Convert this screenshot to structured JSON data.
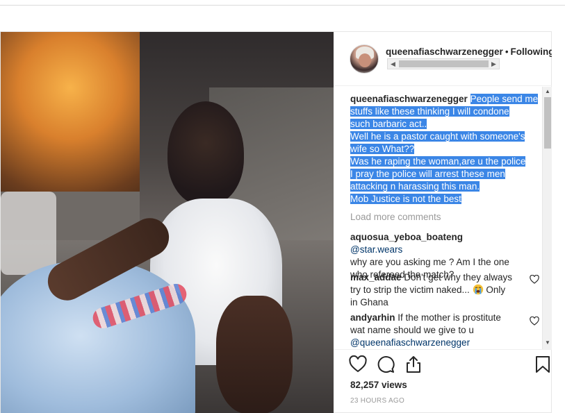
{
  "post": {
    "header": {
      "username": "queenafiaschwarzenegger",
      "separator": "•",
      "follow_status": "Following"
    },
    "caption": {
      "username": "queenafiaschwarzenegger",
      "lines": [
        "People send me",
        "stuffs like these thinking I will condone",
        "such barbaric act..",
        "Well he is a pastor caught with someone's",
        "wife so What??",
        "Was he raping the woman,are u the police",
        "I pray the police will arrest these men",
        "attacking n harassing this man.",
        "Mob Justice is not the best"
      ],
      "highlight_color": "#3b86e6"
    },
    "load_more": "Load more comments",
    "comments": [
      {
        "username": "aquosua_yeboa_boateng",
        "mention": "@star.wears",
        "text_lines": [
          "why are you asking me ? Am I the one",
          "who refereed the match?"
        ]
      },
      {
        "username": "max_addae",
        "text_before_emoji": "Don't get why they always",
        "text_line2": "try to strip the victim naked...",
        "emoji": "loudly-crying-face-emoji",
        "text_after_emoji": "Only",
        "text_line3": "in Ghana"
      },
      {
        "username": "andyarhin",
        "text_lines": [
          "If the mother is prostitute",
          "wat name should we give to u"
        ],
        "mention": "@queenafiaschwarzenegger"
      }
    ],
    "actions": {
      "like_icon": "heart-icon",
      "comment_icon": "comment-icon",
      "share_icon": "share-icon",
      "save_icon": "bookmark-icon"
    },
    "views": "82,257 views",
    "timestamp": "23 HOURS AGO"
  }
}
